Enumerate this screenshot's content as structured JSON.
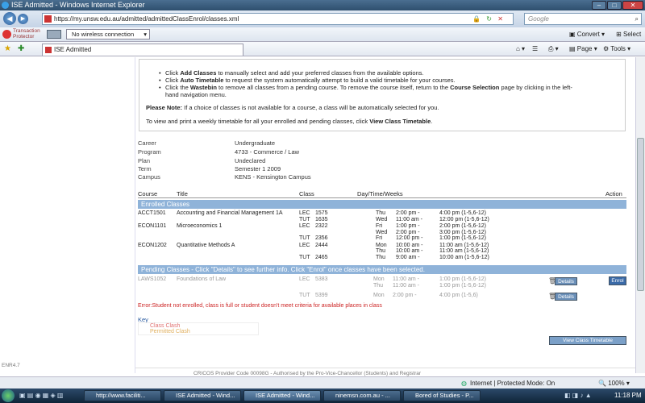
{
  "window": {
    "title": "ISE Admitted - Windows Internet Explorer"
  },
  "address": {
    "url": "https://my.unsw.edu.au/admitted/admittedClassEnrol/classes.xml",
    "search_placeholder": "Google"
  },
  "toolbar2": {
    "tp_line1": "Transaction",
    "tp_line2": "Protector",
    "wireless": "No wireless connection",
    "convert": "Convert",
    "select": "Select"
  },
  "favbar": {
    "tab": "ISE Admitted",
    "page": "Page",
    "tools": "Tools"
  },
  "instructions": {
    "b1_pre": "Click ",
    "b1_bold": "Add Classes",
    "b1_post": " to manually select and add your preferred classes from the available options.",
    "b2_pre": "Click ",
    "b2_bold": "Auto Timetable",
    "b2_post": " to request the system automatically attempt to build a valid timetable for your courses.",
    "b3_pre": "Click the ",
    "b3_bold": "Wastebin",
    "b3_post": " to remove all classes from a pending course. To remove the course itself, return to the ",
    "b3_bold2": "Course Selection",
    "b3_post2": " page by clicking in the left-",
    "b3_line2": "hand navigation menu.",
    "note_bold": "Please Note:",
    "note": " If a choice of classes is not available for a course, a class will be automatically selected for you.",
    "view_pre": "To view and print a weekly timetable for all your enrolled and pending classes, click ",
    "view_bold": "View Class Timetable",
    "view_post": "."
  },
  "info": {
    "career_label": "Career",
    "career": "Undergraduate",
    "program_label": "Program",
    "program": "4733 - Commerce / Law",
    "plan_label": "Plan",
    "plan": "Undeclared",
    "term_label": "Term",
    "term": "Semester 1 2009",
    "campus_label": "Campus",
    "campus": "KENS - Kensington Campus"
  },
  "table": {
    "h_course": "Course",
    "h_title": "Title",
    "h_class": "Class",
    "h_day": "Day/Time/Weeks",
    "h_action": "Action"
  },
  "enrolled_title": "Enrolled Classes",
  "enrolled": [
    {
      "code": "ACCT1501",
      "title": "Accounting and Financial Management 1A",
      "rows": [
        {
          "type": "LEC",
          "num": "1575",
          "day": "Thu",
          "start": "2:00 pm -",
          "end": "4:00 pm (1-5,6-12)"
        },
        {
          "type": "TUT",
          "num": "1635",
          "day": "Wed",
          "start": "11:00 am -",
          "end": "12:00 pm (1-5,6-12)"
        }
      ]
    },
    {
      "code": "ECON1101",
      "title": "Microeconomics 1",
      "rows": [
        {
          "type": "LEC",
          "num": "2322",
          "day": "Fri",
          "start": "1:00 pm -",
          "end": "2:00 pm (1-5,6-12)"
        },
        {
          "type": "",
          "num": "",
          "day": "Wed",
          "start": "2:00 pm -",
          "end": "3:00 pm (1-5,6-12)"
        },
        {
          "type": "TUT",
          "num": "2356",
          "day": "Fri",
          "start": "12:00 pm -",
          "end": "1:00 pm (1-5,6-12)"
        }
      ]
    },
    {
      "code": "ECON1202",
      "title": "Quantitative Methods A",
      "rows": [
        {
          "type": "LEC",
          "num": "2444",
          "day": "Mon",
          "start": "10:00 am -",
          "end": "11:00 am (1-5,6-12)"
        },
        {
          "type": "",
          "num": "",
          "day": "Thu",
          "start": "10:00 am -",
          "end": "11:00 am (1-5,6-12)"
        },
        {
          "type": "TUT",
          "num": "2465",
          "day": "Thu",
          "start": "9:00 am -",
          "end": "10:00 am (1-5,6-12)"
        }
      ]
    }
  ],
  "pending_title": "Pending Classes - Click \"Details\" to see further info. Click \"Enrol\" once classes have been selected.",
  "pending": {
    "code": "LAWS1052",
    "title": "Foundations of Law",
    "rows": [
      {
        "type": "LEC",
        "num": "5383",
        "day": "Mon",
        "start": "11:00 am -",
        "end": "1:00 pm (1-5,6-12)"
      },
      {
        "type": "",
        "num": "",
        "day": "Thu",
        "start": "11:00 am -",
        "end": "1:00 pm (1-5,6-12)"
      },
      {
        "type": "TUT",
        "num": "5399",
        "day": "Mon",
        "start": "2:00 pm -",
        "end": "4:00 pm (1-5,6)"
      }
    ]
  },
  "buttons": {
    "details": "Details",
    "enrol": "Enrol",
    "view_timetable": "View Class Timetable"
  },
  "error": "Error:Student not enrolled, class is full or student doesn't meet criteria for available places in class",
  "key": {
    "title": "Key",
    "clash": "Class Clash",
    "permitted": "Permitted Clash"
  },
  "footer": {
    "code": "ENR4.7",
    "cricos": "CRICOS Provider Code 00098G - Authorised by the Pro-Vice-Chancellor (Students) and Registrar"
  },
  "status": {
    "zone": "Internet | Protected Mode: On",
    "zoom": "100%"
  },
  "taskbar": {
    "t1": "http://www.faciliti...",
    "t2": "ISE Admitted - Wind...",
    "t3": "ISE Admitted - Wind...",
    "t4": "ninemsn.com.au - ...",
    "t5": "Bored of Studies - P...",
    "clock": "11:18 PM"
  },
  "colors": {
    "section_bar": "#8fb3d9",
    "error": "#cc2222",
    "clash": "#e07070",
    "permitted": "#e0b060"
  }
}
